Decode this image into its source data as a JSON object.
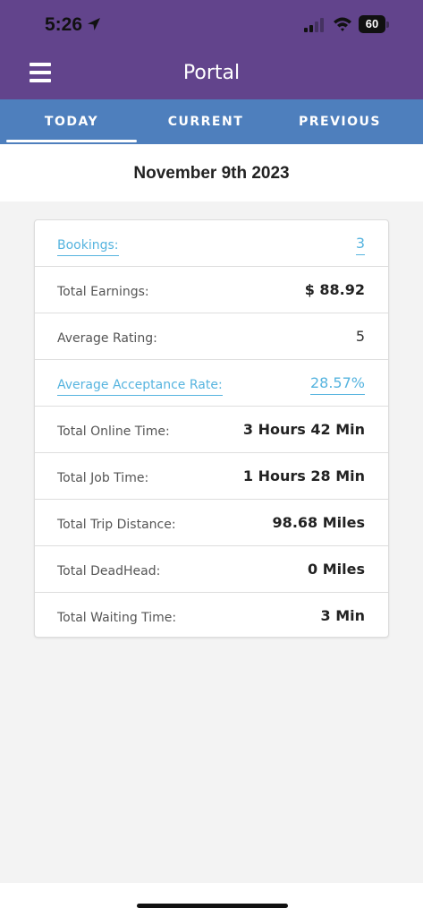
{
  "status_bar": {
    "time": "5:26",
    "battery": "60",
    "icons": [
      "location-arrow-icon",
      "signal-icon",
      "wifi-icon",
      "battery-icon"
    ]
  },
  "header": {
    "title": "Portal",
    "menu_icon": "hamburger-menu-icon",
    "background_color": "#62448c"
  },
  "tabs": {
    "items": [
      {
        "label": "TODAY",
        "selected": true
      },
      {
        "label": "CURRENT",
        "selected": false
      },
      {
        "label": "PREVIOUS",
        "selected": false
      }
    ],
    "background_color": "#4e7fbd"
  },
  "date": "November 9th 2023",
  "stats": [
    {
      "label": "Bookings:",
      "value": "3",
      "link": true
    },
    {
      "label": "Total Earnings:",
      "value": "$ 88.92"
    },
    {
      "label": "Average Rating:",
      "value": "5"
    },
    {
      "label": "Average Acceptance Rate:",
      "value": "28.57%",
      "link": true
    },
    {
      "label": "Total Online Time:",
      "value": "3 Hours 42 Min"
    },
    {
      "label": "Total Job Time:",
      "value": "1 Hours 28 Min"
    },
    {
      "label": "Total Trip Distance:",
      "value": "98.68 Miles"
    },
    {
      "label": "Total DeadHead:",
      "value": "0 Miles"
    },
    {
      "label": "Total Waiting Time:",
      "value": "3 Min"
    }
  ],
  "colors": {
    "link": "#56b4df"
  }
}
